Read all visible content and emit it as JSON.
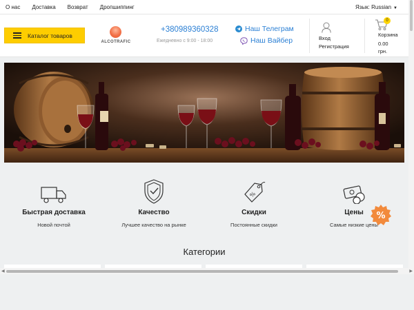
{
  "topbar": {
    "nav": [
      "О нас",
      "Доставка",
      "Возврат",
      "Дропшиппинг"
    ],
    "language_label": "Язык:",
    "language_value": "Russian"
  },
  "header": {
    "catalog_label": "Каталог товаров",
    "logo_text": "ALCOTRAFIC",
    "phone": "+380989360328",
    "hours": "Ежедневно с 9:00 - 18:00",
    "telegram_label": "Наш Телеграм",
    "viber_label": "Наш Вайбер",
    "login_label": "Вход",
    "register_label": "Регистрация",
    "cart_count": "0",
    "cart_label": "Корзина",
    "cart_amount": "0.00",
    "cart_currency": "грн."
  },
  "features": [
    {
      "icon": "delivery-truck-icon",
      "title": "Быстрая доставка",
      "subtitle": "Новой почтой"
    },
    {
      "icon": "quality-shield-icon",
      "title": "Качество",
      "subtitle": "Лучшее качество на рынке"
    },
    {
      "icon": "discount-tag-icon",
      "title": "Скидки",
      "subtitle": "Постоянные скидки"
    },
    {
      "icon": "money-coins-icon",
      "title": "Цены",
      "subtitle": "Самые низкие цены"
    }
  ],
  "section_title": "Категории",
  "colors": {
    "accent_yellow": "#fecd00",
    "link_blue": "#2a7fd4",
    "promo_orange": "#f28a3c",
    "background": "#eef0f1"
  }
}
